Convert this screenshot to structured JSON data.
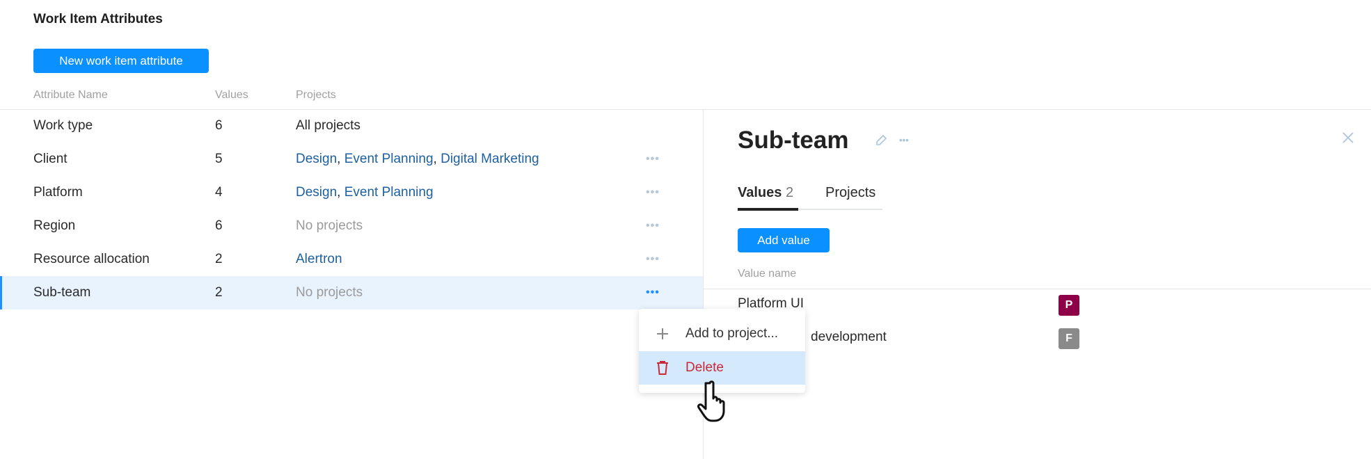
{
  "page_title": "Work Item Attributes",
  "new_button": "New work item attribute",
  "columns": [
    "Attribute Name",
    "Values",
    "Projects"
  ],
  "rows": [
    {
      "name": "Work type",
      "values": "6",
      "projects": [
        {
          "label": "All projects",
          "kind": "plain"
        }
      ]
    },
    {
      "name": "Client",
      "values": "5",
      "projects": [
        {
          "label": "Design",
          "kind": "link"
        },
        {
          "label": "Event Planning",
          "kind": "link"
        },
        {
          "label": "Digital Marketing",
          "kind": "link"
        }
      ]
    },
    {
      "name": "Platform",
      "values": "4",
      "projects": [
        {
          "label": "Design",
          "kind": "link"
        },
        {
          "label": "Event Planning",
          "kind": "link"
        }
      ]
    },
    {
      "name": "Region",
      "values": "6",
      "projects": [
        {
          "label": "No projects",
          "kind": "muted"
        }
      ]
    },
    {
      "name": "Resource allocation",
      "values": "2",
      "projects": [
        {
          "label": "Alertron",
          "kind": "link"
        }
      ]
    },
    {
      "name": "Sub-team",
      "values": "2",
      "projects": [
        {
          "label": "No projects",
          "kind": "muted"
        }
      ]
    }
  ],
  "more_glyph": "•••",
  "panel": {
    "title": "Sub-team",
    "tabs": [
      {
        "label": "Values",
        "count": "2"
      },
      {
        "label": "Projects"
      }
    ],
    "add_value": "Add value",
    "value_header": "Value name",
    "values": [
      {
        "name": "Platform UI",
        "badge": "P",
        "color": "#8e0047"
      },
      {
        "name": "development",
        "badge": "F",
        "color": "#8a8a8a"
      }
    ]
  },
  "menu": {
    "items": [
      {
        "label": "Add to project..."
      },
      {
        "label": "Delete"
      }
    ]
  },
  "colors": {
    "accent": "#0a90ff",
    "danger": "#c8283a",
    "selected_bg": "#e8f3fd"
  }
}
